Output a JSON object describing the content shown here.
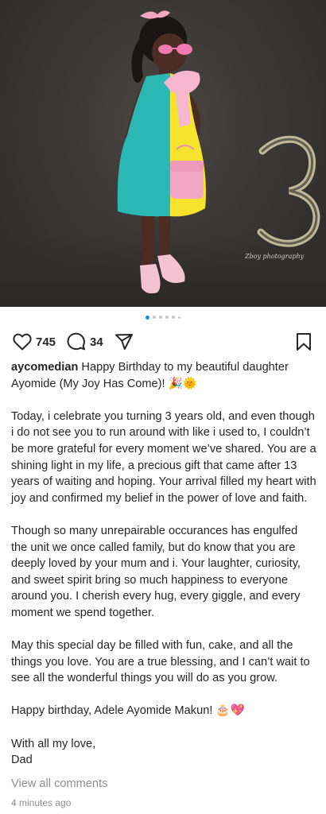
{
  "post": {
    "photo": {
      "alt_subject": "photo",
      "watermark": "Zboy photography"
    },
    "carousel": {
      "count": 6,
      "active_index": 0
    },
    "actions": {
      "like_count": "745",
      "comment_count": "34"
    },
    "caption": {
      "username": "aycomedian",
      "paragraphs": [
        "Happy Birthday to my beautiful daughter Ayomide (My Joy Has Come)! 🎉🌞",
        "Today, i celebrate you turning 3 years old, and even though i do not see you to run around with like i used to, I couldn’t be more grateful for every moment we’ve shared. You are a shining light in my life, a precious gift that came after 13 years of waiting and hoping. Your arrival filled my heart with joy and confirmed my belief in the power of love and faith.",
        "Though so many unrepairable occurances has engulfed the unit we once called family, but do know that you are deeply loved by your mum and i. Your laughter, curiosity, and sweet spirit bring so much happiness to everyone around you. I cherish every hug, every giggle, and every moment we spend together.",
        "May this special day be filled with fun, cake, and all the things you love. You are a true blessing, and I can’t wait to see all the wonderful things you will do as you grow.",
        "Happy birthday, Adele Ayomide Makun! 🎂💖"
      ],
      "signoff_line1": "With all my love,",
      "signoff_line2": "Dad"
    },
    "view_comments": "View all comments",
    "timestamp": "4 minutes ago"
  },
  "colors": {
    "accent_blue": "#0095f6",
    "text": "#262626",
    "muted": "#8e8e8e"
  }
}
